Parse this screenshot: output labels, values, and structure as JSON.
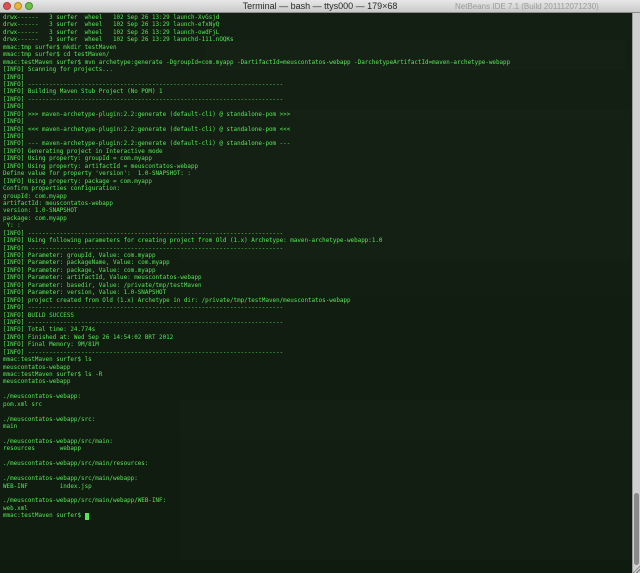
{
  "window": {
    "title": "Terminal — bash — ttys000 — 179×68",
    "background_title": "NetBeans IDE 7.1 (Build 201112071230)"
  },
  "colors": {
    "terminal_text": "#57e657",
    "titlebar_top": "#e8e8e8",
    "titlebar_bottom": "#c9c9c9"
  },
  "terminal": {
    "lines": [
      "drwx------   3 surfer  wheel   102 Sep 26 13:29 launch-XvGsjd",
      "drwx------   3 surfer  wheel   102 Sep 26 13:29 launch-efxNyQ",
      "drwx------   3 surfer  wheel   102 Sep 26 13:29 launch-owdFjL",
      "drwx------   3 surfer  wheel   102 Sep 26 13:29 launchd-111.nOQKs",
      "mmac:tmp surfer$ mkdir testMaven",
      "mmac:tmp surfer$ cd testMaven/",
      "mmac:testMaven surfer$ mvn archetype:generate -DgroupId=com.myapp -DartifactId=meuscontatos-webapp -DarchetypeArtifactId=maven-archetype-webapp",
      "[INFO] Scanning for projects...",
      "[INFO]",
      "[INFO] ------------------------------------------------------------------------",
      "[INFO] Building Maven Stub Project (No POM) 1",
      "[INFO] ------------------------------------------------------------------------",
      "[INFO]",
      "[INFO] >>> maven-archetype-plugin:2.2:generate (default-cli) @ standalone-pom >>>",
      "[INFO]",
      "[INFO] <<< maven-archetype-plugin:2.2:generate (default-cli) @ standalone-pom <<<",
      "[INFO]",
      "[INFO] --- maven-archetype-plugin:2.2:generate (default-cli) @ standalone-pom ---",
      "[INFO] Generating project in Interactive mode",
      "[INFO] Using property: groupId = com.myapp",
      "[INFO] Using property: artifactId = meuscontatos-webapp",
      "Define value for property 'version':  1.0-SNAPSHOT: :",
      "[INFO] Using property: package = com.myapp",
      "Confirm properties configuration:",
      "groupId: com.myapp",
      "artifactId: meuscontatos-webapp",
      "version: 1.0-SNAPSHOT",
      "package: com.myapp",
      " Y: :",
      "[INFO] ------------------------------------------------------------------------",
      "[INFO] Using following parameters for creating project from Old (1.x) Archetype: maven-archetype-webapp:1.0",
      "[INFO] ------------------------------------------------------------------------",
      "[INFO] Parameter: groupId, Value: com.myapp",
      "[INFO] Parameter: packageName, Value: com.myapp",
      "[INFO] Parameter: package, Value: com.myapp",
      "[INFO] Parameter: artifactId, Value: meuscontatos-webapp",
      "[INFO] Parameter: basedir, Value: /private/tmp/testMaven",
      "[INFO] Parameter: version, Value: 1.0-SNAPSHOT",
      "[INFO] project created from Old (1.x) Archetype in dir: /private/tmp/testMaven/meuscontatos-webapp",
      "[INFO] ------------------------------------------------------------------------",
      "[INFO] BUILD SUCCESS",
      "[INFO] ------------------------------------------------------------------------",
      "[INFO] Total time: 24.774s",
      "[INFO] Finished at: Wed Sep 26 14:54:02 BRT 2012",
      "[INFO] Final Memory: 9M/81M",
      "[INFO] ------------------------------------------------------------------------",
      "mmac:testMaven surfer$ ls",
      "meuscontatos-webapp",
      "mmac:testMaven surfer$ ls -R",
      "meuscontatos-webapp",
      "",
      "./meuscontatos-webapp:",
      "pom.xml src",
      "",
      "./meuscontatos-webapp/src:",
      "main",
      "",
      "./meuscontatos-webapp/src/main:",
      "resources       webapp",
      "",
      "./meuscontatos-webapp/src/main/resources:",
      "",
      "./meuscontatos-webapp/src/main/webapp:",
      "WEB-INF         index.jsp",
      "",
      "./meuscontatos-webapp/src/main/webapp/WEB-INF:",
      "web.xml",
      "mmac:testMaven surfer$ "
    ]
  }
}
